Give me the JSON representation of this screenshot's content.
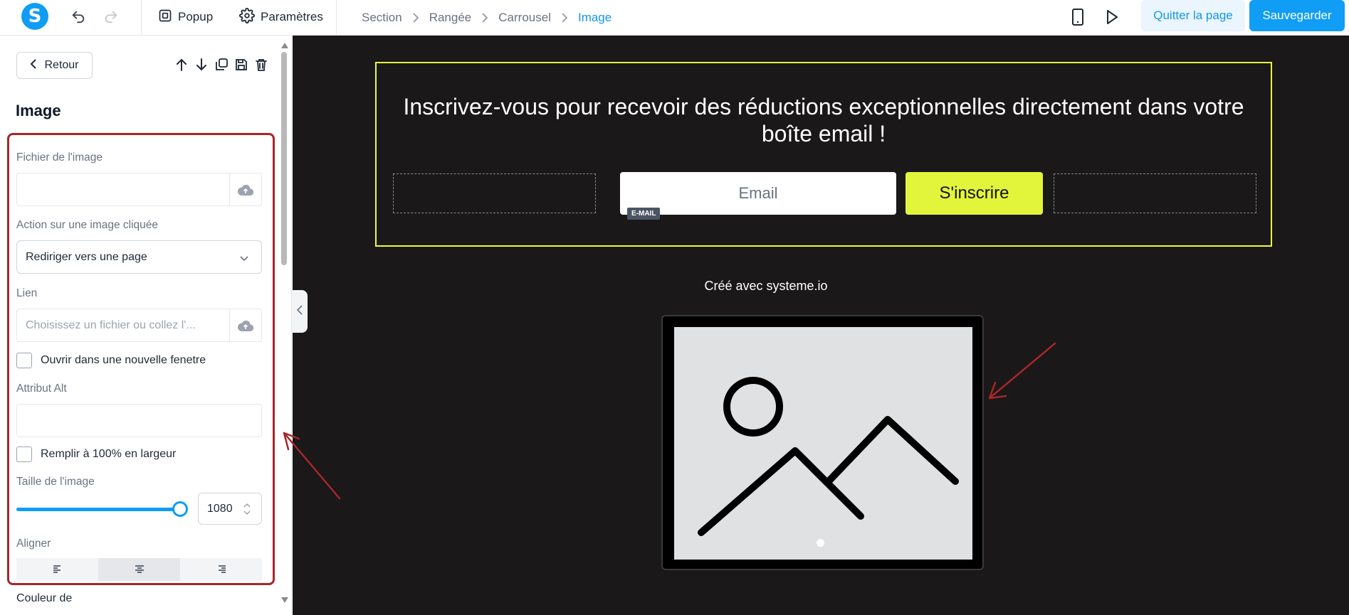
{
  "topbar": {
    "popup_label": "Popup",
    "settings_label": "Paramètres",
    "breadcrumb": [
      "Section",
      "Rangée",
      "Carrousel",
      "Image"
    ],
    "quit_label": "Quitter la page",
    "save_label": "Sauvegarder"
  },
  "sidebar": {
    "back_label": "Retour",
    "panel_title": "Image",
    "image_file_label": "Fichier de l'image",
    "click_action_label": "Action sur une image cliquée",
    "click_action_value": "Rediriger vers une page",
    "link_label": "Lien",
    "link_placeholder": "Choisissez un fichier ou collez l'...",
    "new_window_label": "Ouvrir dans une nouvelle fenetre",
    "alt_label": "Attribut Alt",
    "full_width_label": "Remplir à 100% en largeur",
    "size_label": "Taille de l'image",
    "size_value": "1080",
    "align_label": "Aligner",
    "align_selected": "center",
    "color_label": "Couleur de"
  },
  "canvas": {
    "signup_title": "Inscrivez-vous pour recevoir des réductions exceptionnelles directement dans votre boîte email !",
    "email_placeholder": "Email",
    "email_tag": "E-MAIL",
    "signup_button": "S'inscrire",
    "credit": "Créé avec systeme.io"
  },
  "colors": {
    "accent": "#0f9df5",
    "canvas_bg": "#1a1818",
    "signup_border": "#e8ff3d",
    "signup_button_bg": "#e3f53a",
    "annotation": "#a7262a"
  },
  "icons": [
    "logo-s-icon",
    "undo-icon",
    "redo-icon",
    "popup-icon",
    "gear-icon",
    "chevron-right-icon",
    "mobile-icon",
    "play-icon",
    "chevron-left-icon",
    "arrow-up-icon",
    "arrow-down-icon",
    "copy-icon",
    "save-icon",
    "trash-icon",
    "cloud-upload-icon",
    "chevron-down-icon",
    "align-left-icon",
    "align-center-icon",
    "align-right-icon",
    "image-placeholder-icon"
  ]
}
